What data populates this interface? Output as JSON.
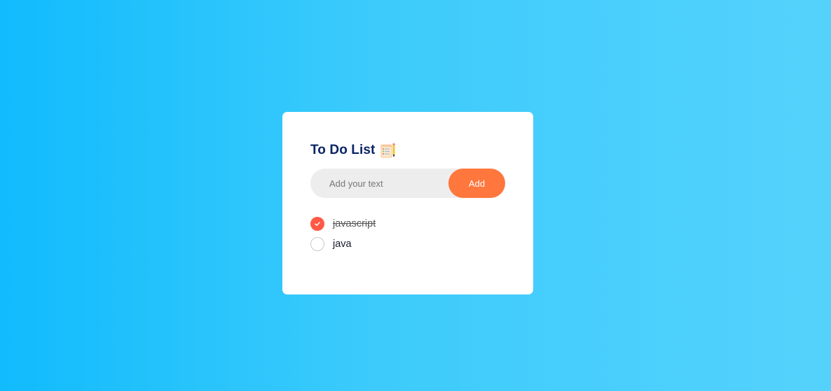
{
  "app": {
    "title": "To Do List",
    "title_icon": "notepad-icon"
  },
  "form": {
    "placeholder": "Add your text",
    "value": "",
    "add_label": "Add"
  },
  "tasks": [
    {
      "text": "javascript",
      "checked": true
    },
    {
      "text": "java",
      "checked": false
    }
  ],
  "colors": {
    "background_start": "#11bbfd",
    "background_end": "#55d2fc",
    "title": "#0a2463",
    "accent": "#ff773d",
    "checked": "#ff5945",
    "input_bg": "#ededed"
  }
}
